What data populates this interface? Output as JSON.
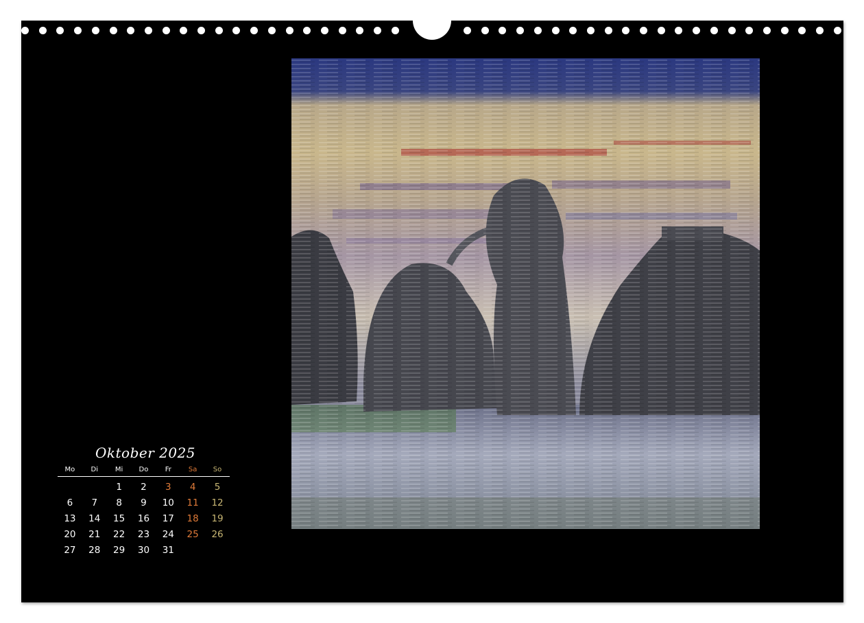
{
  "calendar": {
    "title": "Oktober 2025",
    "weekdays": [
      "Mo",
      "Di",
      "Mi",
      "Do",
      "Fr",
      "Sa",
      "So"
    ],
    "weeks": [
      [
        "",
        "",
        "1",
        "2",
        "3",
        "4",
        "5"
      ],
      [
        "6",
        "7",
        "8",
        "9",
        "10",
        "11",
        "12"
      ],
      [
        "13",
        "14",
        "15",
        "16",
        "17",
        "18",
        "19"
      ],
      [
        "20",
        "21",
        "22",
        "23",
        "24",
        "25",
        "26"
      ],
      [
        "27",
        "28",
        "29",
        "30",
        "31",
        "",
        ""
      ]
    ],
    "highlighted_weekdays": [
      "3"
    ],
    "colors": {
      "weekday": "#ffffff",
      "saturday": "#e07b39",
      "sunday": "#c9b774",
      "holiday": "#e07b39"
    }
  },
  "artwork": {
    "icon": "rock-formation-painting",
    "colors": {
      "sky_top": "#2c3a7a",
      "sky_band": "#c8b68e",
      "red_streak": "#a52a2a",
      "rocks": "#3f4047",
      "sea": "#9aa0b4",
      "grass": "#4d7a3c"
    }
  }
}
